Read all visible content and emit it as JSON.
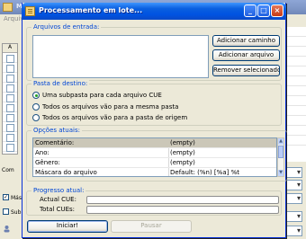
{
  "background_window": {
    "title": "Me",
    "menu": "Arquivo",
    "grid_header": "A",
    "label_comp": "Com",
    "label_mas": "Más",
    "label_sub": "Sub"
  },
  "dialog": {
    "title": "Processamento em lote...",
    "title_buttons": {
      "minimize": "_",
      "maximize": "□",
      "close": "×"
    },
    "input_files": {
      "group_title": "Arquivos de entrada:",
      "add_path_label": "Adicionar caminho",
      "add_file_label": "Adicionar arquivo",
      "remove_selected_label": "Remover selecionados"
    },
    "destination": {
      "group_title": "Pasta de destino:",
      "options": [
        {
          "label": "Uma subpasta para cada arquivo CUE",
          "checked": true
        },
        {
          "label": "Todos os arquivos vão para a mesma pasta",
          "checked": false
        },
        {
          "label": "Todos os arquivos vão para a pasta de origem",
          "checked": false
        }
      ]
    },
    "current_options": {
      "group_title": "Opções atuais:",
      "rows": [
        {
          "key": "Comentário:",
          "value": "(empty)",
          "selected": true
        },
        {
          "key": "Ano:",
          "value": "(empty)",
          "selected": false
        },
        {
          "key": "Gênero:",
          "value": "(empty)",
          "selected": false
        },
        {
          "key": "Máscara do arquivo",
          "value": "Default: (%n) [%a] %t",
          "selected": false
        }
      ]
    },
    "progress": {
      "group_title": "Progresso atual:",
      "cue_label": "Actual CUE:",
      "cue_value": 0,
      "total_label": "Total CUEs:",
      "total_value": 0
    },
    "start_label": "Iniciar!",
    "pause_label": "Pausar"
  }
}
